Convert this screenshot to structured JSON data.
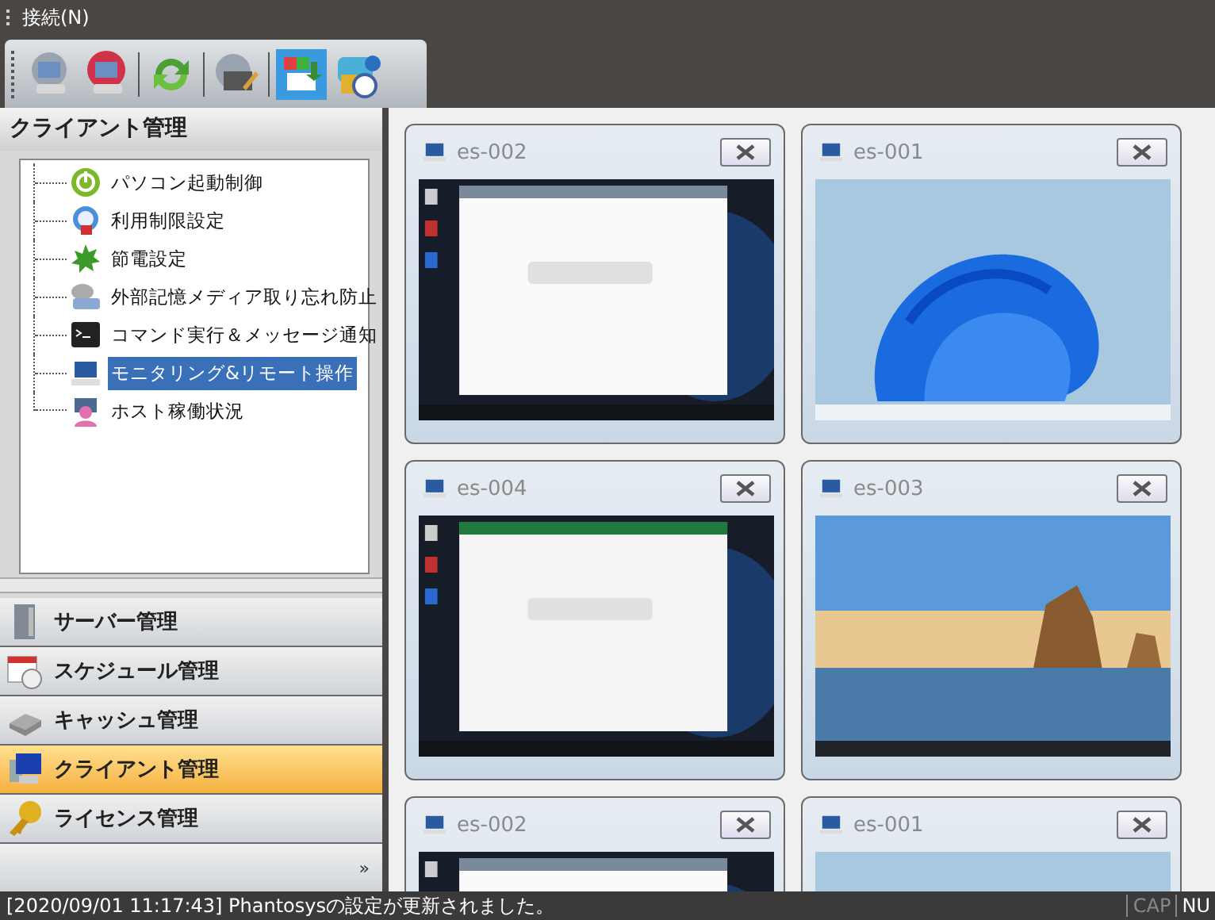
{
  "menu": [
    {
      "label": "接続(N)"
    }
  ],
  "panel": {
    "title": "クライアント管理",
    "tree": [
      {
        "label": "パソコン起動制御",
        "selected": false
      },
      {
        "label": "利用制限設定",
        "selected": false
      },
      {
        "label": "節電設定",
        "selected": false
      },
      {
        "label": "外部記憶メディア取り忘れ防止",
        "selected": false
      },
      {
        "label": "コマンド実行＆メッセージ通知",
        "selected": false
      },
      {
        "label": "モニタリング&リモート操作",
        "selected": true
      },
      {
        "label": "ホスト稼働状況",
        "selected": false
      }
    ]
  },
  "nav": [
    {
      "label": "サーバー管理",
      "selected": false
    },
    {
      "label": "スケジュール管理",
      "selected": false
    },
    {
      "label": "キャッシュ管理",
      "selected": false
    },
    {
      "label": "クライアント管理",
      "selected": true
    },
    {
      "label": "ライセンス管理",
      "selected": false
    }
  ],
  "nav_more": "»",
  "screens": [
    {
      "name": "es-002",
      "kind": "picture"
    },
    {
      "name": "es-001",
      "kind": "picture"
    },
    {
      "name": "es-004",
      "kind": "picture"
    },
    {
      "name": "es-003",
      "kind": "picture"
    },
    {
      "name": "es-002",
      "kind": "picture"
    },
    {
      "name": "es-001",
      "kind": "picture"
    }
  ],
  "status_bar": {
    "message": "[2020/09/01 11:17:43] Phantosysの設定が更新されました。",
    "indicators": [
      {
        "label": "CAP",
        "on": false
      },
      {
        "label": "NU",
        "on": true
      }
    ]
  }
}
